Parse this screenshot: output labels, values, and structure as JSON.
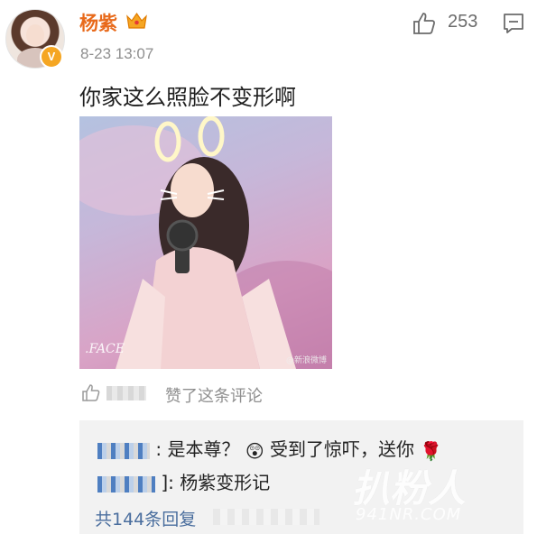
{
  "post": {
    "username": "杨紫",
    "timestamp": "8-23 13:07",
    "like_count": "253",
    "comment_text": "你家这么照脸不变形啊",
    "photo": {
      "watermark_left": ".FACE",
      "watermark_right": "@新浪微博"
    },
    "liked_by_text": "赞了这条评论",
    "icons": {
      "avatar_badge": "V",
      "vip": "crown-icon",
      "like": "thumbs-up-icon",
      "comment": "comment-icon"
    }
  },
  "replies": {
    "items": [
      {
        "separator": ":",
        "text": "是本尊？",
        "emoji": "😲",
        "text2": "受到了惊吓，送你",
        "emoji2": "🌹"
      },
      {
        "separator": "]:",
        "text": "杨紫变形记"
      }
    ],
    "view_all": "共144条回复"
  },
  "overlay": {
    "site_mark": "扒粉人",
    "site_url": "941NR.COM"
  },
  "colors": {
    "username": "#e86a1b",
    "link": "#4a6e9e",
    "reply_bg": "#f2f2f2"
  }
}
